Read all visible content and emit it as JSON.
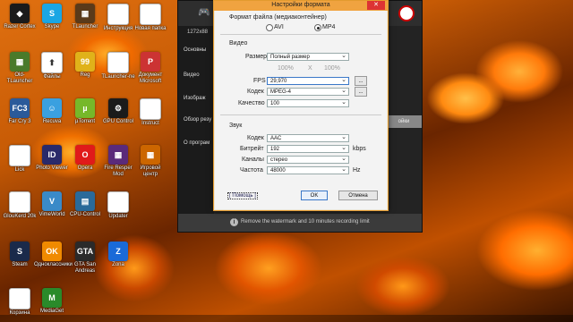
{
  "desktop": {
    "icons": [
      {
        "label": "Razer Cortex",
        "color": "#1b1b1b",
        "glyph": "◆"
      },
      {
        "label": "Skype",
        "color": "#1aa6e4",
        "glyph": "S"
      },
      {
        "label": "TLauncher",
        "color": "#5a3a1a",
        "glyph": "▦"
      },
      {
        "label": "Инструкция",
        "color": "#ffffff",
        "glyph": ""
      },
      {
        "label": "Новая папка",
        "color": "#ffffff",
        "glyph": ""
      },
      {
        "label": "Old-TLauncher",
        "color": "#4a7a2a",
        "glyph": "▦"
      },
      {
        "label": "Файлы",
        "color": "#ffffff",
        "glyph": "⬆"
      },
      {
        "label": "Reg",
        "color": "#e0b21a",
        "glyph": "99"
      },
      {
        "label": "TLauncher-ne",
        "color": "#ffffff",
        "glyph": ""
      },
      {
        "label": "Документ Microsoft",
        "color": "#c33",
        "glyph": "P"
      },
      {
        "label": "Far Cry 3",
        "color": "#2a5a9a",
        "glyph": "FC3"
      },
      {
        "label": "Recuva",
        "color": "#3aa0e0",
        "glyph": "☺"
      },
      {
        "label": "µTorrent",
        "color": "#76b82a",
        "glyph": "µ"
      },
      {
        "label": "GPU Control",
        "color": "#1b1b1b",
        "glyph": "⚙"
      },
      {
        "label": "Instruct",
        "color": "#ffffff",
        "glyph": ""
      },
      {
        "label": "Lick",
        "color": "#ffffff",
        "glyph": ""
      },
      {
        "label": "Photo Viewer",
        "color": "#2a2a6a",
        "glyph": "ID"
      },
      {
        "label": "Opera",
        "color": "#e01a1a",
        "glyph": "O"
      },
      {
        "label": "Fire Resper Mod",
        "color": "#5a2a7a",
        "glyph": "▦"
      },
      {
        "label": "Игровой центр",
        "color": "#cc6600",
        "glyph": "▦"
      },
      {
        "label": "GlouKerd 20k",
        "color": "#ffffff",
        "glyph": ""
      },
      {
        "label": "VimeWorld",
        "color": "#3a8ac8",
        "glyph": "V"
      },
      {
        "label": "CPU-Control",
        "color": "#2a6a9a",
        "glyph": "▤"
      },
      {
        "label": "Updater",
        "color": "#ffffff",
        "glyph": ""
      },
      {
        "label": "Steam",
        "color": "#1a2a4a",
        "glyph": "S"
      },
      {
        "label": "Одноклассники",
        "color": "#f08a00",
        "glyph": "OK"
      },
      {
        "label": "GTA San Andreas",
        "color": "#2a2a2a",
        "glyph": "GTA"
      },
      {
        "label": "Zona",
        "color": "#1a6ad8",
        "glyph": "Z"
      },
      {
        "label": "Корзина",
        "color": "#ffffff",
        "glyph": ""
      },
      {
        "label": "MediaGet",
        "color": "#2a8a2a",
        "glyph": "M"
      }
    ]
  },
  "app": {
    "sidebar": [
      "Основны",
      "Видео",
      "Изображ",
      "Обзор резу",
      "О програм"
    ],
    "filename": "1272x88",
    "right_button": "ойки",
    "footer": "Remove the watermark and 10 minutes recording limit",
    "info_icon": "i"
  },
  "dialog": {
    "title": "Настройки формата",
    "close": "✕",
    "format_label": "Формат файла (медиаконтейнер)",
    "format_avi": "AVI",
    "format_mp4": "MP4",
    "video_section": "Видео",
    "size_label": "Размер",
    "size_value": "Полный размер",
    "size_w_pct": "100%",
    "size_x": "X",
    "size_h_pct": "100%",
    "fps_label": "FPS",
    "fps_value": "29,970",
    "codec_label": "Кодек",
    "codec_value": "MPEG-4",
    "quality_label": "Качество",
    "quality_value": "100",
    "more_btn": "...",
    "audio_section": "Звук",
    "acodec_label": "Кодек",
    "acodec_value": "AAC",
    "bitrate_label": "Битрейт",
    "bitrate_value": "192",
    "bitrate_unit": "kbps",
    "channels_label": "Каналы",
    "channels_value": "стерео",
    "freq_label": "Частота",
    "freq_value": "48000",
    "freq_unit": "Hz",
    "help": "[ Помощь ]",
    "ok": "OK",
    "cancel": "Отмена"
  }
}
